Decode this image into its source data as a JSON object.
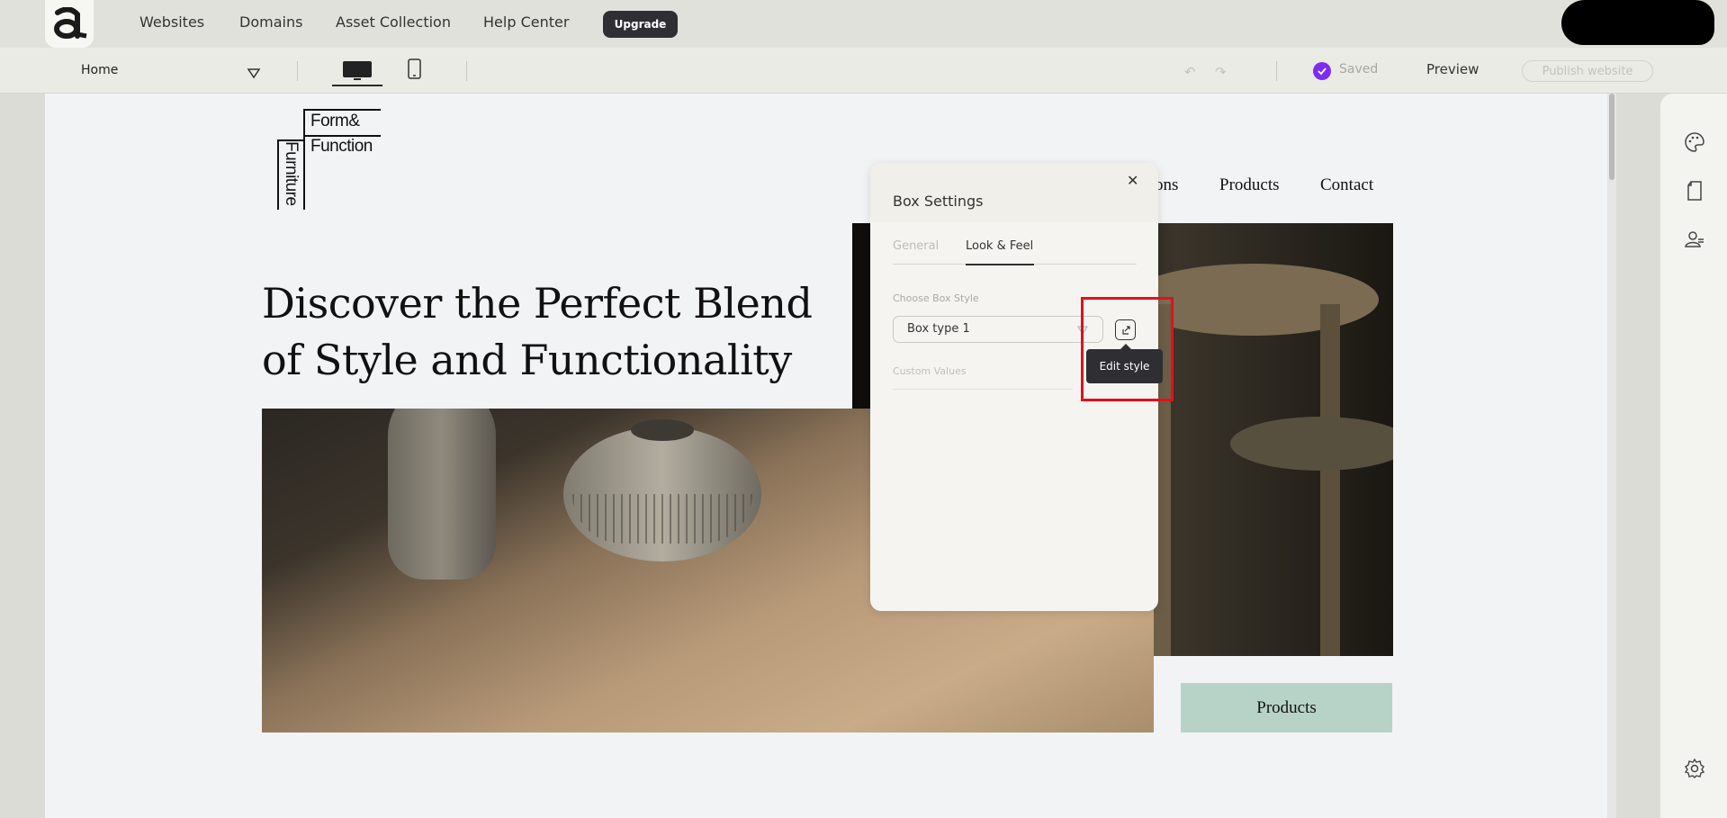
{
  "topnav": {
    "logo_icon": "app-logo-icon",
    "links": [
      "Websites",
      "Domains",
      "Asset Collection",
      "Help Center"
    ],
    "upgrade_label": "Upgrade"
  },
  "toolbar": {
    "page_name": "Home",
    "saved_label": "Saved",
    "preview_label": "Preview",
    "publish_label": "Publish website"
  },
  "site": {
    "logo_line1": "Form&",
    "logo_line2": "Function",
    "logo_vertical": "Furniture",
    "nav": [
      "ons",
      "Products",
      "Contact"
    ],
    "headline": "Discover the Perfect Blend of Style and Functionality",
    "products_button": "Products"
  },
  "panel": {
    "title": "Box Settings",
    "tabs": [
      "General",
      "Look & Feel"
    ],
    "active_tab": "Look & Feel",
    "choose_label": "Choose Box Style",
    "box_style_value": "Box type 1",
    "custom_label": "Custom Values",
    "tooltip": "Edit style"
  },
  "colors": {
    "accent_purple": "#7d2cf0",
    "highlight_red": "#e3101b",
    "products_button_bg": "#b7d3c8"
  }
}
